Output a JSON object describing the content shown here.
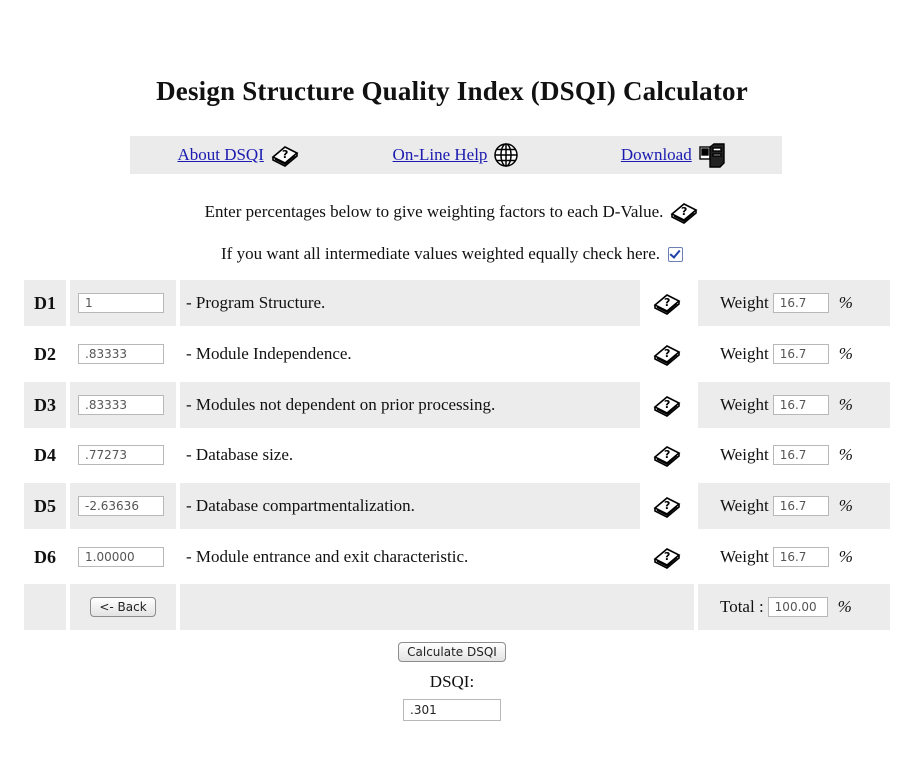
{
  "page": {
    "title": "Design Structure Quality Index (DSQI) Calculator"
  },
  "nav": {
    "about": "About DSQI",
    "help": "On-Line Help",
    "download": "Download"
  },
  "instructions": {
    "line1": "Enter percentages below to give weighting factors to each D-Value.",
    "line2": "If you want all intermediate values weighted equally check here."
  },
  "equal_weight_checked": true,
  "weight_label": "Weight",
  "percent_sign": "%",
  "rows": [
    {
      "label": "D1",
      "value": "1",
      "description": "- Program Structure.",
      "weight": "16.7"
    },
    {
      "label": "D2",
      "value": ".83333",
      "description": "- Module Independence.",
      "weight": "16.7"
    },
    {
      "label": "D3",
      "value": ".83333",
      "description": "- Modules not dependent on prior processing.",
      "weight": "16.7"
    },
    {
      "label": "D4",
      "value": ".77273",
      "description": "- Database size.",
      "weight": "16.7"
    },
    {
      "label": "D5",
      "value": "-2.63636",
      "description": "- Database compartmentalization.",
      "weight": "16.7"
    },
    {
      "label": "D6",
      "value": "1.00000",
      "description": "- Module entrance and exit characteristic.",
      "weight": "16.7"
    }
  ],
  "footer": {
    "back_label": "<- Back",
    "total_label": "Total :",
    "total_value": "100.00"
  },
  "calc": {
    "button_label": "Calculate DSQI",
    "result_label": "DSQI:",
    "result_value": ".301"
  },
  "icons": {
    "help_book": "book-question-icon",
    "globe": "globe-icon",
    "download": "download-computer-icon"
  }
}
